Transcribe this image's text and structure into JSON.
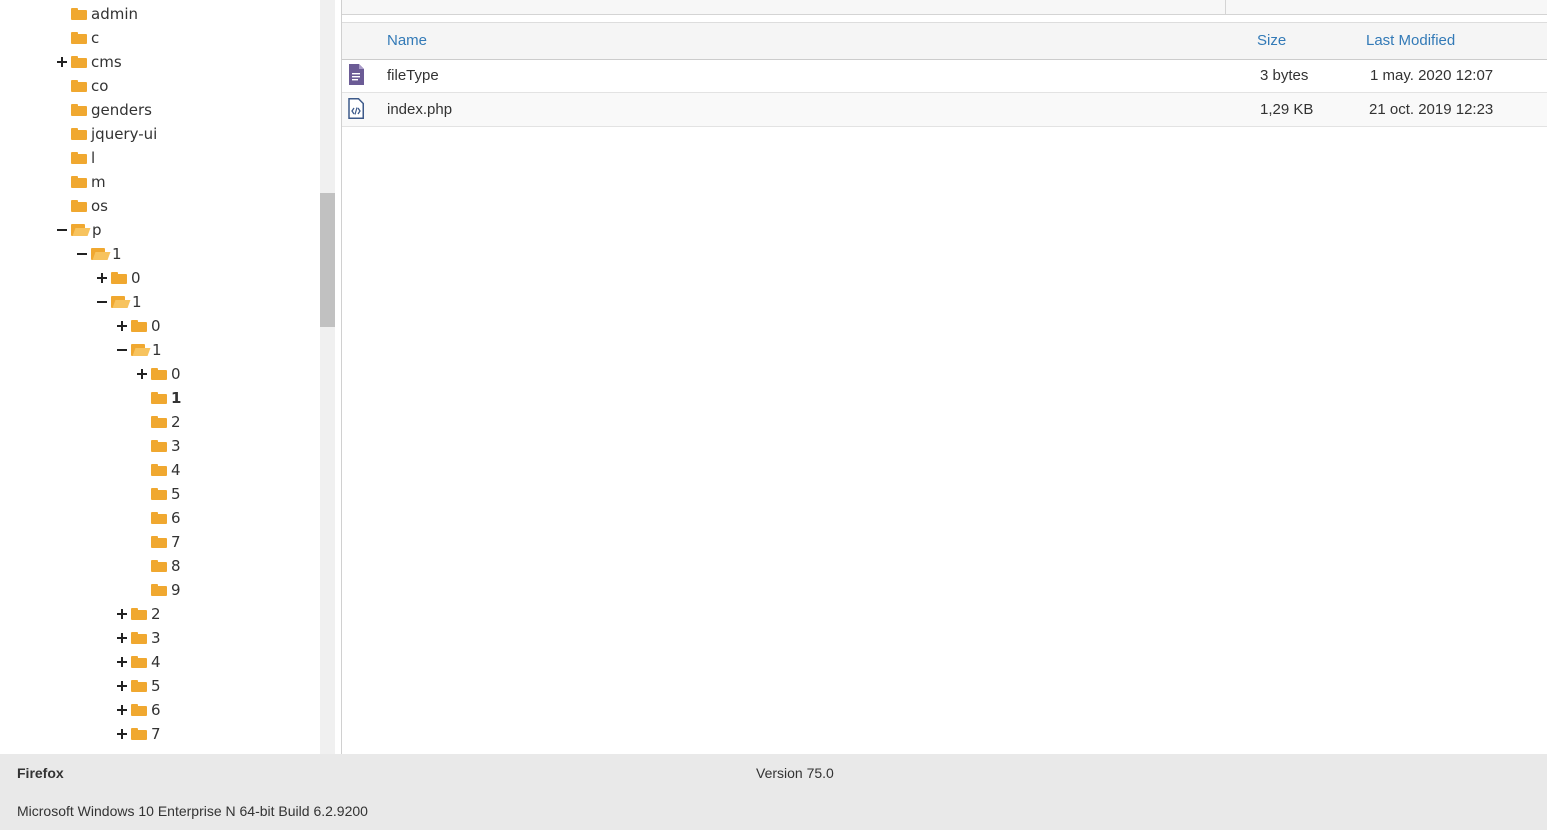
{
  "tree": {
    "items": [
      {
        "label": "admin",
        "toggle": "none",
        "open": false,
        "bold": false,
        "depth": 0
      },
      {
        "label": "c",
        "toggle": "none",
        "open": false,
        "bold": false,
        "depth": 0
      },
      {
        "label": "cms",
        "toggle": "plus",
        "open": false,
        "bold": false,
        "depth": 0
      },
      {
        "label": "co",
        "toggle": "none",
        "open": false,
        "bold": false,
        "depth": 0
      },
      {
        "label": "genders",
        "toggle": "none",
        "open": false,
        "bold": false,
        "depth": 0
      },
      {
        "label": "jquery-ui",
        "toggle": "none",
        "open": false,
        "bold": false,
        "depth": 0
      },
      {
        "label": "l",
        "toggle": "none",
        "open": false,
        "bold": false,
        "depth": 0
      },
      {
        "label": "m",
        "toggle": "none",
        "open": false,
        "bold": false,
        "depth": 0
      },
      {
        "label": "os",
        "toggle": "none",
        "open": false,
        "bold": false,
        "depth": 0
      },
      {
        "label": "p",
        "toggle": "minus",
        "open": true,
        "bold": false,
        "depth": 0
      },
      {
        "label": "1",
        "toggle": "minus",
        "open": true,
        "bold": false,
        "depth": 1
      },
      {
        "label": "0",
        "toggle": "plus",
        "open": false,
        "bold": false,
        "depth": 2
      },
      {
        "label": "1",
        "toggle": "minus",
        "open": true,
        "bold": false,
        "depth": 2
      },
      {
        "label": "0",
        "toggle": "plus",
        "open": false,
        "bold": false,
        "depth": 3
      },
      {
        "label": "1",
        "toggle": "minus",
        "open": true,
        "bold": false,
        "depth": 3
      },
      {
        "label": "0",
        "toggle": "plus",
        "open": false,
        "bold": false,
        "depth": 4
      },
      {
        "label": "1",
        "toggle": "none",
        "open": false,
        "bold": true,
        "depth": 4
      },
      {
        "label": "2",
        "toggle": "none",
        "open": false,
        "bold": false,
        "depth": 4
      },
      {
        "label": "3",
        "toggle": "none",
        "open": false,
        "bold": false,
        "depth": 4
      },
      {
        "label": "4",
        "toggle": "none",
        "open": false,
        "bold": false,
        "depth": 4
      },
      {
        "label": "5",
        "toggle": "none",
        "open": false,
        "bold": false,
        "depth": 4
      },
      {
        "label": "6",
        "toggle": "none",
        "open": false,
        "bold": false,
        "depth": 4
      },
      {
        "label": "7",
        "toggle": "none",
        "open": false,
        "bold": false,
        "depth": 4
      },
      {
        "label": "8",
        "toggle": "none",
        "open": false,
        "bold": false,
        "depth": 4
      },
      {
        "label": "9",
        "toggle": "none",
        "open": false,
        "bold": false,
        "depth": 4
      },
      {
        "label": "2",
        "toggle": "plus",
        "open": false,
        "bold": false,
        "depth": 3
      },
      {
        "label": "3",
        "toggle": "plus",
        "open": false,
        "bold": false,
        "depth": 3
      },
      {
        "label": "4",
        "toggle": "plus",
        "open": false,
        "bold": false,
        "depth": 3
      },
      {
        "label": "5",
        "toggle": "plus",
        "open": false,
        "bold": false,
        "depth": 3
      },
      {
        "label": "6",
        "toggle": "plus",
        "open": false,
        "bold": false,
        "depth": 3
      },
      {
        "label": "7",
        "toggle": "plus",
        "open": false,
        "bold": false,
        "depth": 3
      }
    ]
  },
  "table": {
    "headers": {
      "name": "Name",
      "size": "Size",
      "modified": "Last Modified"
    },
    "rows": [
      {
        "name": "fileType",
        "size": "3 bytes",
        "modified": "1 may. 2020 12:07",
        "icon": "text-file-icon"
      },
      {
        "name": "index.php",
        "size": "1,29 KB",
        "modified": "21 oct. 2019 12:23",
        "icon": "code-file-icon"
      }
    ]
  },
  "colors": {
    "folder": "#F0A830",
    "link": "#337ab7",
    "footer_bg": "#e9e9e9"
  },
  "footer": {
    "browser": "Firefox",
    "version": "Version 75.0",
    "os": "Microsoft Windows 10 Enterprise N 64-bit Build 6.2.9200"
  }
}
